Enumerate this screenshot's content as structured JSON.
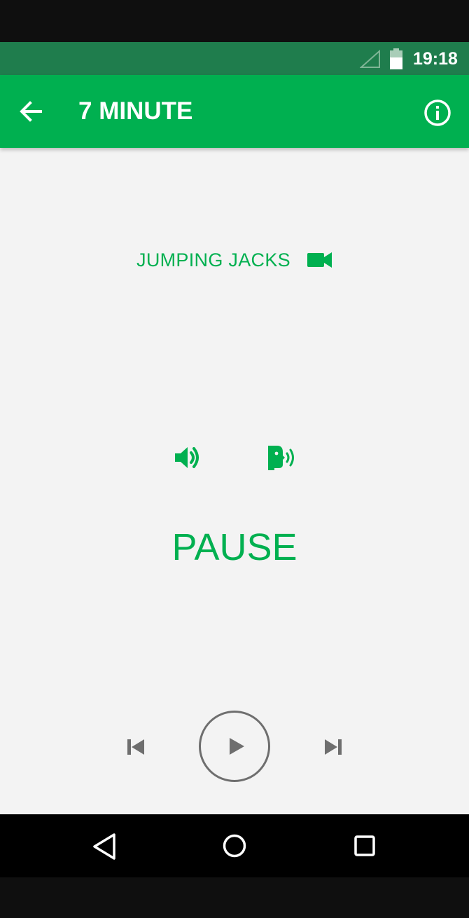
{
  "status_bar": {
    "time": "19:18",
    "signal_icon": "signal-empty-icon",
    "battery_icon": "battery-icon"
  },
  "app_bar": {
    "title": "7 MINUTE",
    "back_icon": "arrow-back-icon",
    "info_icon": "info-icon"
  },
  "exercise": {
    "name": "JUMPING JACKS",
    "video_icon": "videocam-icon"
  },
  "audio_controls": {
    "sound_icon": "volume-up-icon",
    "voice_icon": "record-voice-icon"
  },
  "state_label": "PAUSE",
  "playback": {
    "previous_icon": "skip-previous-icon",
    "play_icon": "play-icon",
    "next_icon": "skip-next-icon"
  },
  "nav_bar": {
    "back_icon": "nav-back-icon",
    "home_icon": "nav-home-icon",
    "recents_icon": "nav-recents-icon"
  },
  "colors": {
    "accent": "#00b050",
    "status_bar": "#1f7d4d",
    "background": "#f3f3f3",
    "control_gray": "#6e6e6e"
  }
}
